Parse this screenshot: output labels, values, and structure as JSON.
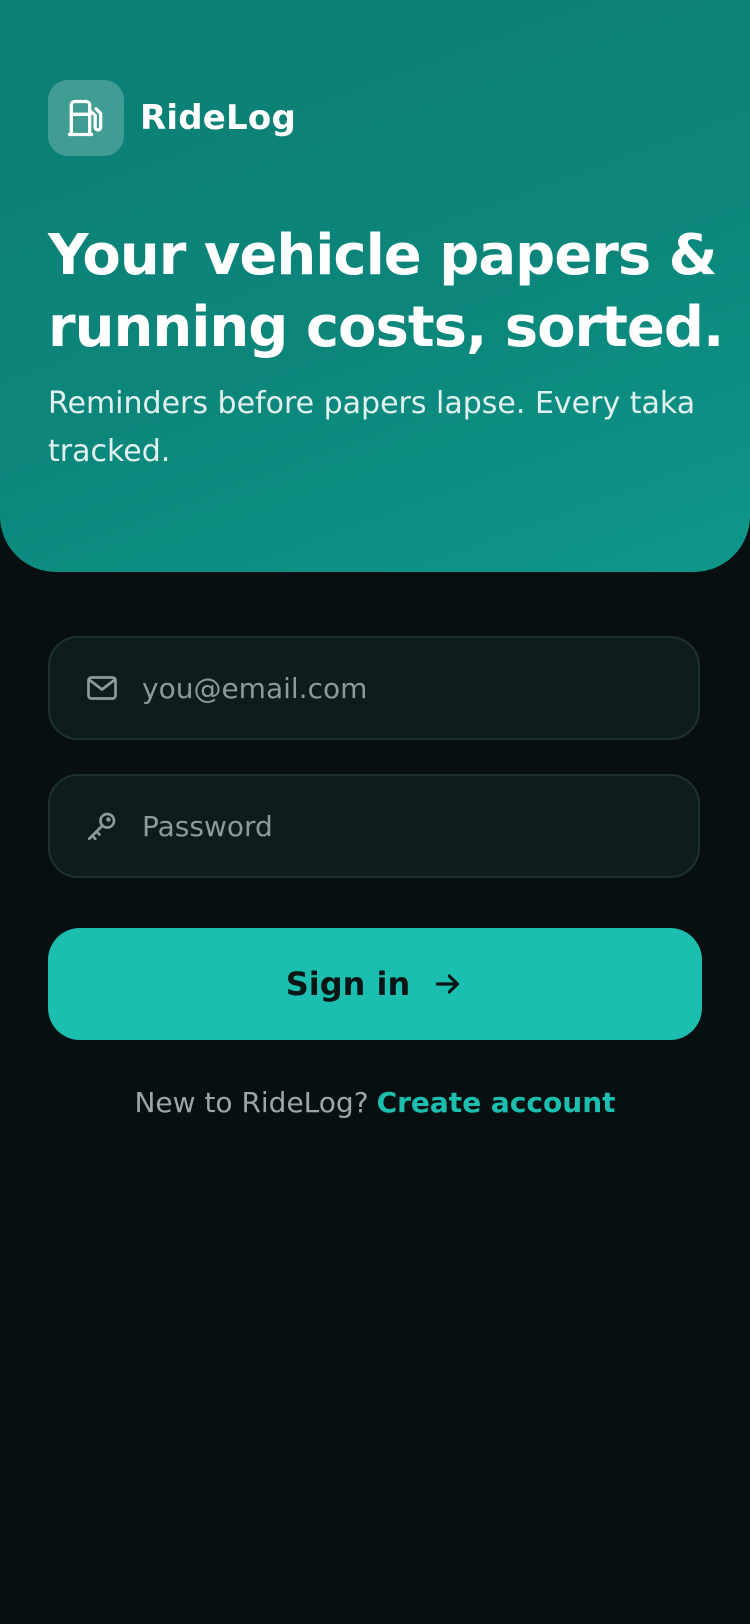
{
  "brand": {
    "name": "RideLog",
    "icon": "fuel-pump-icon"
  },
  "hero": {
    "headline": "Your vehicle papers & running costs, sorted.",
    "subline": "Reminders before papers lapse. Every taka tracked."
  },
  "form": {
    "email": {
      "placeholder": "you@email.com",
      "value": "",
      "icon": "mail-icon"
    },
    "password": {
      "placeholder": "Password",
      "value": "",
      "icon": "key-icon"
    },
    "submit_label": "Sign in",
    "submit_icon": "arrow-right-icon"
  },
  "footer": {
    "prompt": "New to RideLog?",
    "link_label": "Create account"
  },
  "colors": {
    "accent": "#1cbfaf",
    "hero": "#0c867b",
    "background": "#070f11",
    "field": "#0f1c1e"
  }
}
